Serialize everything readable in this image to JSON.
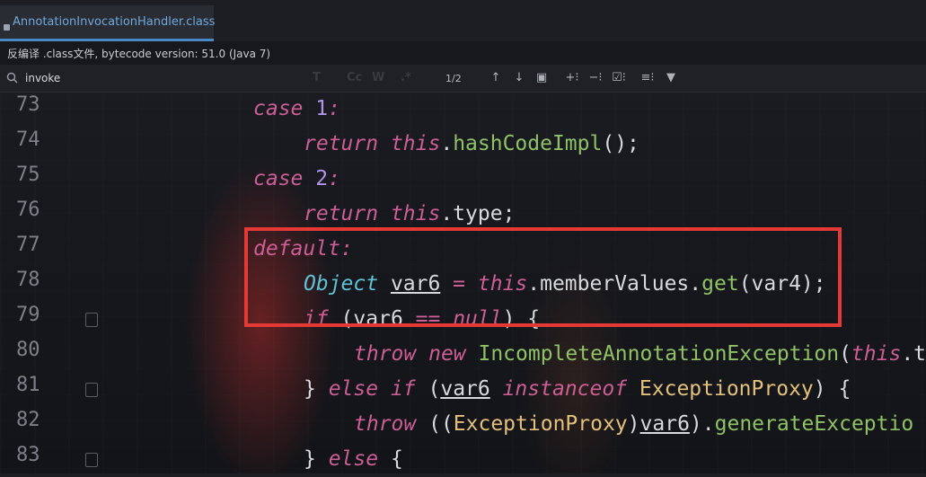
{
  "tab": {
    "label": "AnnotationInvocationHandler.class",
    "icon": "class-file-icon"
  },
  "infobar": {
    "text": "反编译 .class文件, bytecode version: 51.0 (Java 7)"
  },
  "search": {
    "value": "invoke",
    "count": "1/2"
  },
  "toolbar": {
    "icons": [
      "arrow-up-icon",
      "arrow-down-icon",
      "select-all-occurrences-icon",
      "add-selection-icon",
      "remove-selection-icon",
      "select-all-icon",
      "filter-options-icon",
      "filter-icon"
    ],
    "glyphs": [
      "↑",
      "↓",
      "▣",
      "+⁝",
      "−⁝",
      "☑⁝",
      "≡⁝",
      "▼"
    ]
  },
  "line_numbers": [
    "73",
    "74",
    "75",
    "76",
    "77",
    "78",
    "79",
    "80",
    "81",
    "82",
    "83"
  ],
  "code_lines": [
    {
      "no": "73",
      "tokens": [
        [
          "kw",
          "case "
        ],
        [
          "num",
          "1"
        ],
        [
          "kw",
          ":"
        ]
      ]
    },
    {
      "no": "74",
      "tokens": [
        [
          "kw",
          "return "
        ],
        [
          "kw",
          "this"
        ],
        [
          "pl",
          "."
        ],
        [
          "fn",
          "hashCodeImpl"
        ],
        [
          "pl",
          "();"
        ]
      ]
    },
    {
      "no": "75",
      "tokens": [
        [
          "kw",
          "case "
        ],
        [
          "num",
          "2"
        ],
        [
          "kw",
          ":"
        ]
      ]
    },
    {
      "no": "76",
      "tokens": [
        [
          "kw",
          "return "
        ],
        [
          "kw",
          "this"
        ],
        [
          "pl",
          ".type;"
        ]
      ]
    },
    {
      "no": "77",
      "tokens": [
        [
          "kw",
          "default"
        ],
        [
          "kw",
          ":"
        ]
      ]
    },
    {
      "no": "78",
      "tokens": [
        [
          "ty",
          "Object "
        ],
        [
          "var",
          "var6"
        ],
        [
          "op",
          " = "
        ],
        [
          "kw",
          "this"
        ],
        [
          "pl",
          ".memberValues."
        ],
        [
          "fn",
          "get"
        ],
        [
          "pl",
          "(var4);"
        ]
      ]
    },
    {
      "no": "79",
      "tokens": [
        [
          "kw",
          "if "
        ],
        [
          "pl",
          "("
        ],
        [
          "pl",
          "var6"
        ],
        [
          "op",
          " == "
        ],
        [
          "kw",
          "null"
        ],
        [
          "pl",
          ") {"
        ]
      ]
    },
    {
      "no": "80",
      "tokens": [
        [
          "kw",
          "throw "
        ],
        [
          "kw",
          "new "
        ],
        [
          "fn",
          "IncompleteAnnotationException"
        ],
        [
          "pl",
          "("
        ],
        [
          "kw",
          "this"
        ],
        [
          "pl",
          ".t"
        ]
      ]
    },
    {
      "no": "81",
      "tokens": [
        [
          "pl",
          "} "
        ],
        [
          "kw",
          "else if "
        ],
        [
          "pl",
          "("
        ],
        [
          "var",
          "var6"
        ],
        [
          "kw",
          " instanceof "
        ],
        [
          "cls",
          "ExceptionProxy"
        ],
        [
          "pl",
          ") {"
        ]
      ]
    },
    {
      "no": "82",
      "tokens": [
        [
          "kw",
          "throw "
        ],
        [
          "pl",
          "(("
        ],
        [
          "cls",
          "ExceptionProxy"
        ],
        [
          "pl",
          ")"
        ],
        [
          "var",
          "var6"
        ],
        [
          "pl",
          ")."
        ],
        [
          "fn",
          "generateExceptio"
        ]
      ]
    },
    {
      "no": "83",
      "tokens": [
        [
          "pl",
          "} "
        ],
        [
          "kw",
          "else "
        ],
        [
          "pl",
          "{"
        ]
      ]
    }
  ],
  "colors": {
    "highlight_box": "#e53935",
    "tab_underline": "#4a88c7"
  }
}
